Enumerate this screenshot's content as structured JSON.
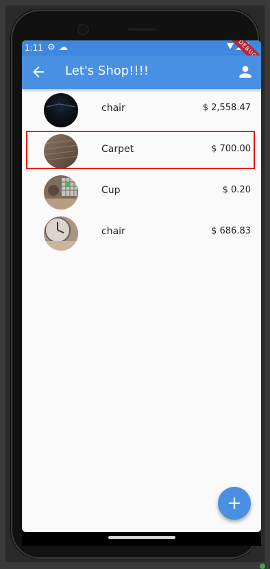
{
  "status_bar": {
    "time": "1:11",
    "gear_icon": "gear-icon",
    "cloud_icon": "cloud-icon",
    "wifi_icon": "wifi-icon",
    "signal_icon": "signal-icon",
    "battery_icon": "battery-icon",
    "debug_label": "DEBUG"
  },
  "app_bar": {
    "title": "Let's Shop!!!!",
    "back_icon": "arrow-left-icon",
    "account_icon": "person-icon",
    "background_color": "#4a90e2"
  },
  "items": [
    {
      "name": "chair",
      "price": "$ 2,558.47"
    },
    {
      "name": "Carpet",
      "price": "$ 700.00"
    },
    {
      "name": "Cup",
      "price": "$ 0.20"
    },
    {
      "name": "chair",
      "price": "$ 686.83"
    }
  ],
  "fab": {
    "label": "+"
  }
}
